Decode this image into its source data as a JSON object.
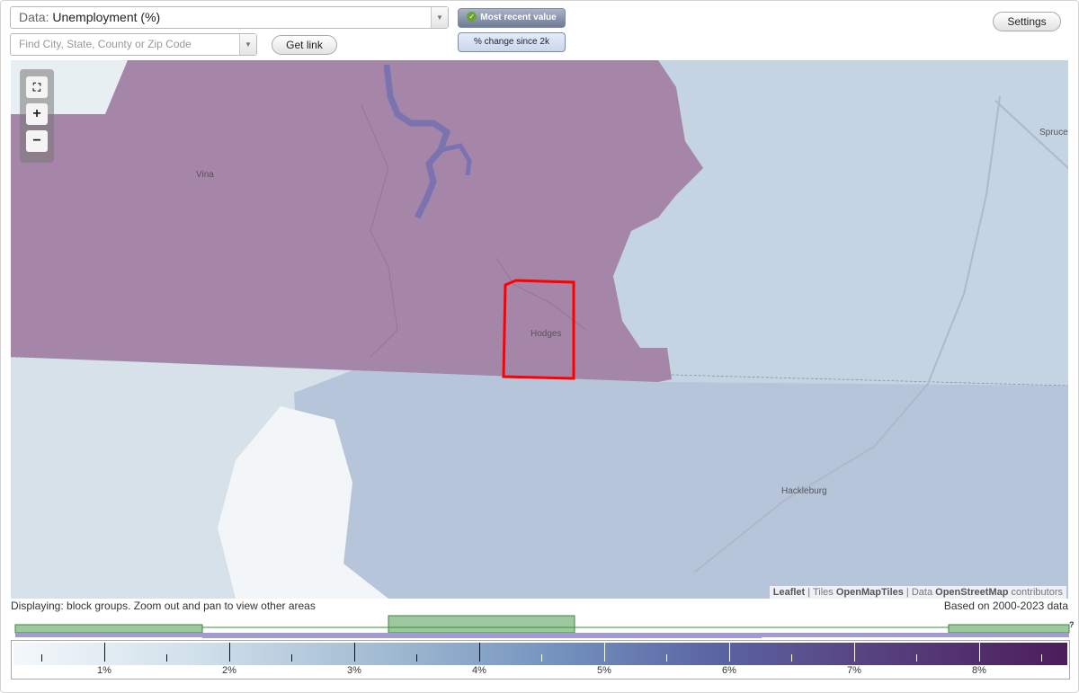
{
  "controls": {
    "data_prefix": "Data:",
    "data_value": "Unemployment (%)",
    "search_placeholder": "Find City, State, County or Zip Code",
    "get_link_label": "Get link",
    "toggle_recent_label": "Most recent value",
    "toggle_change_label": "% change since 2k",
    "settings_label": "Settings"
  },
  "map": {
    "places": [
      "Vina",
      "Spruce",
      "Hodges",
      "Hackleburg"
    ],
    "attribution": {
      "leaflet": "Leaflet",
      "tiles_prefix": "Tiles",
      "tiles": "OpenMapTiles",
      "data_prefix": "Data",
      "data": "OpenStreetMap",
      "suffix": "contributors"
    },
    "colors": {
      "high_area": "#a686a8",
      "mid_area": "#b7c5da",
      "low_area": "#d6e1e9",
      "lightest_area": "#f2f6f8",
      "selected_outline": "#ff0000",
      "water": "#7a73b0"
    }
  },
  "status": {
    "left": "Displaying: block groups. Zoom out and pan to view other areas",
    "right": "Based on 2000-2023 data",
    "help": "?"
  },
  "legend": {
    "labels": [
      "1%",
      "2%",
      "3%",
      "4%",
      "5%",
      "6%",
      "7%",
      "8%"
    ]
  }
}
